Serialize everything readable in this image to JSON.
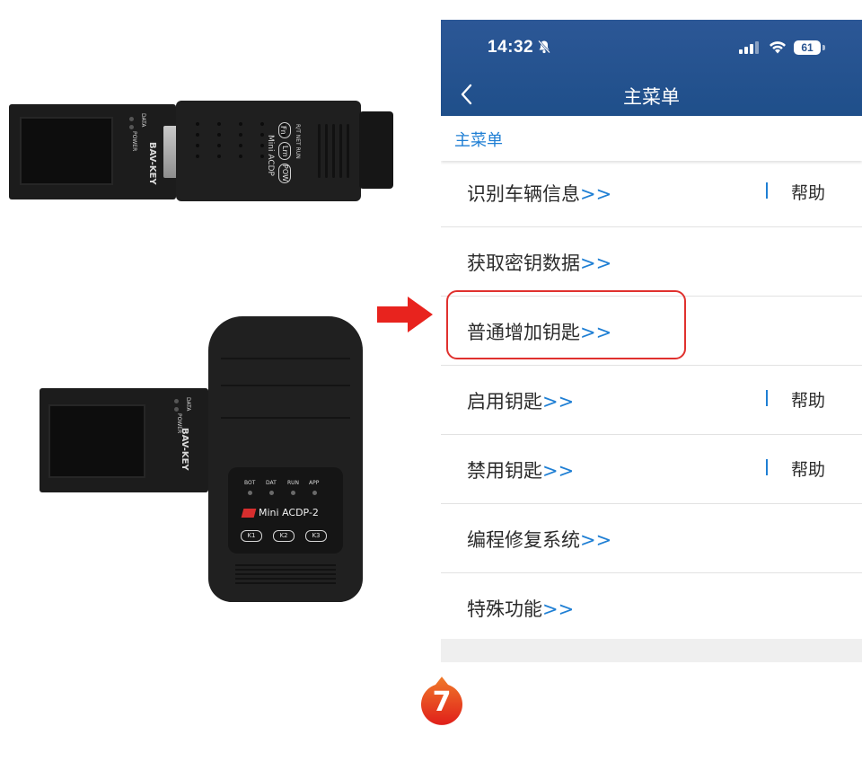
{
  "devices": {
    "bav_key": {
      "brand_label": "BAV-KEY",
      "led_labels": [
        "DATA",
        "POWER"
      ]
    },
    "mini_acdp": {
      "model_label": "Mini ACDP",
      "buttons": [
        "Fn",
        "Lrn",
        "POW"
      ],
      "led_labels": [
        "R/T",
        "NET",
        "RUN"
      ]
    },
    "mini_acdp_2": {
      "model_label": "Mini ACDP-2",
      "led_labels": [
        "BOT",
        "DAT",
        "RUN",
        "APP"
      ],
      "buttons": [
        "K1",
        "K2",
        "K3"
      ]
    }
  },
  "arrow_color": "#e8231e",
  "phone": {
    "status_bar": {
      "time": "14:32",
      "battery": "61",
      "icons": [
        "bell-slash-icon",
        "signal-icon",
        "wifi-icon",
        "battery-icon"
      ]
    },
    "nav": {
      "back_icon": "chevron-left-icon",
      "title": "主菜单"
    },
    "breadcrumb": "主菜单",
    "menu": {
      "arrow_text": ">>",
      "help_label": "帮助",
      "items": [
        {
          "label": "识别车辆信息",
          "has_help": true,
          "highlighted": false
        },
        {
          "label": "获取密钥数据",
          "has_help": false,
          "highlighted": false
        },
        {
          "label": "普通增加钥匙",
          "has_help": false,
          "highlighted": true
        },
        {
          "label": "启用钥匙",
          "has_help": true,
          "highlighted": false
        },
        {
          "label": "禁用钥匙",
          "has_help": true,
          "highlighted": false
        },
        {
          "label": "编程修复系统",
          "has_help": false,
          "highlighted": false
        },
        {
          "label": "特殊功能",
          "has_help": false,
          "highlighted": false
        }
      ]
    },
    "colors": {
      "header": "#25528f",
      "link": "#1f7fd4",
      "highlight": "#e0312e"
    }
  },
  "step": {
    "number": "7",
    "color": "#e8261f"
  }
}
